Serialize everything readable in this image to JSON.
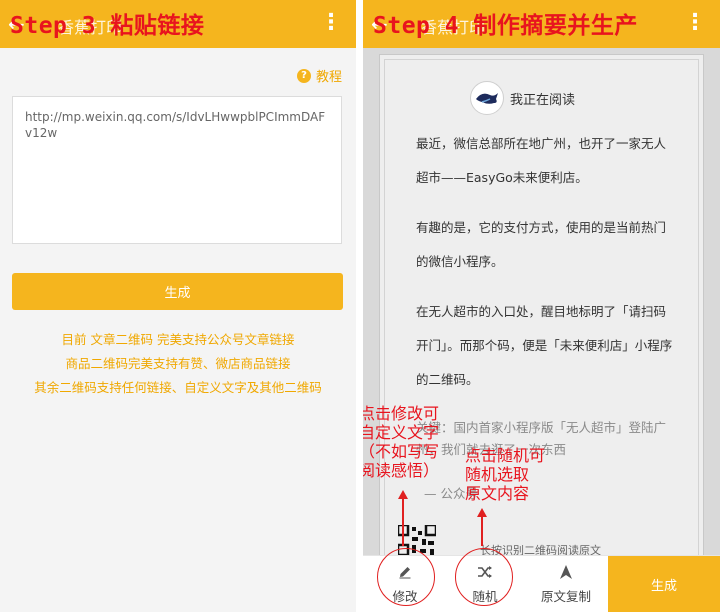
{
  "left": {
    "step_title": "Step 3 粘贴链接",
    "app_title": "香蕉打印",
    "help_label": "教程",
    "url_value": "http://mp.weixin.qq.com/s/IdvLHwwpblPCImmDAFv12w",
    "generate_label": "生成",
    "info_lines": [
      "目前 文章二维码 完美支持公众号文章链接",
      "商品二维码完美支持有赞、微店商品链接",
      "其余二维码支持任何链接、自定义文字及其他二维码"
    ]
  },
  "right": {
    "step_title": "Step 4 制作摘要并生产",
    "app_title": "香蕉打印",
    "reading_label": "我正在阅读",
    "paragraphs": [
      "最近，微信总部所在地广州，也开了一家无人超市——EasyGo未来便利店。",
      "有趣的是，它的支付方式，使用的是当前热门的微信小程序。",
      "在无人超市的入口处，醒目地标明了「请扫码开门」。而那个码，便是「未来便利店」小程序的二维码。"
    ],
    "faded_lines": [
      "关键：国内首家小程序版「无人超市」登陆广",
      "州，我们就去逛了一次东西",
      "— 公众号"
    ],
    "qr_caption": "长按识别二维码阅读原文",
    "toolbar": {
      "edit_label": "修改",
      "random_label": "随机",
      "copy_label": "原文复制",
      "generate_label": "生成"
    },
    "annotations": {
      "edit_note": [
        "点击修改可",
        "自定义文字",
        "（不如写写",
        "阅读感悟）"
      ],
      "random_note": [
        "点击随机可",
        "随机选取",
        "原文内容"
      ]
    }
  },
  "colors": {
    "accent": "#f5b51e",
    "accent_text": "#f0a800",
    "annotation_red": "#e8141e"
  }
}
